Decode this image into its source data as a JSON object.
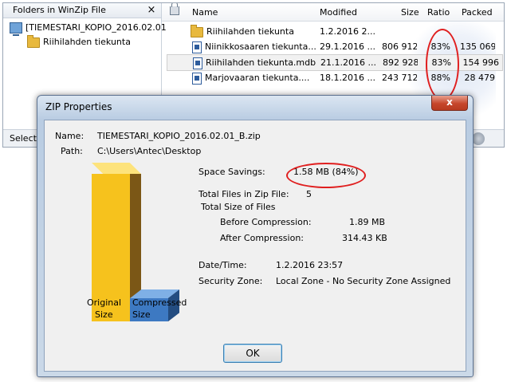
{
  "folders_pane": {
    "title": "Folders in WinZip File",
    "close": "×",
    "tree": [
      {
        "label": "[TIEMESTARI_KOPIO_2016.02.01"
      },
      {
        "label": "Riihilahden tiekunta"
      }
    ]
  },
  "status": {
    "text": "Selecte"
  },
  "file_list": {
    "columns": [
      "Name",
      "Modified",
      "Size",
      "Ratio",
      "Packed"
    ],
    "rows": [
      {
        "name": "Riihilahden tiekunta",
        "modified": "1.2.2016 2...",
        "size": "",
        "ratio": "",
        "packed": "",
        "type": "folder"
      },
      {
        "name": "Niinikkosaaren tiekunta...",
        "modified": "29.1.2016 ...",
        "size": "806 912",
        "ratio": "83%",
        "packed": "135 069",
        "type": "file"
      },
      {
        "name": "Riihilahden tiekunta.mdb",
        "modified": "21.1.2016 ...",
        "size": "892 928",
        "ratio": "83%",
        "packed": "154 996",
        "type": "file"
      },
      {
        "name": "Marjovaaran tiekunta....",
        "modified": "18.1.2016 ...",
        "size": "243 712",
        "ratio": "88%",
        "packed": "28 479",
        "type": "file"
      }
    ]
  },
  "dialog": {
    "title": "ZIP Properties",
    "close": "x",
    "name_label": "Name:",
    "name_value": "TIEMESTARI_KOPIO_2016.02.01_B.zip",
    "path_label": "Path:",
    "path_value": "C:\\Users\\Antec\\Desktop",
    "space_savings_label": "Space Savings:",
    "space_savings_value": "1.58 MB (84%)",
    "total_files_label": "Total Files in Zip File:",
    "total_files_value": "5",
    "total_size_label": "Total Size of Files",
    "before_label": "Before Compression:",
    "before_value": "1.89 MB",
    "after_label": "After Compression:",
    "after_value": "314.43 KB",
    "datetime_label": "Date/Time:",
    "datetime_value": "1.2.2016  23:57",
    "zone_label": "Security Zone:",
    "zone_value": "Local Zone - No Security Zone Assigned",
    "bar_original": [
      "Original",
      "Size"
    ],
    "bar_compressed": [
      "Compressed",
      "Size"
    ],
    "ok": "OK"
  },
  "colors": {
    "highlight_ellipse": "#e01f1f",
    "original_bar": "#f6c21d",
    "compressed_bar": "#3d79c2"
  }
}
